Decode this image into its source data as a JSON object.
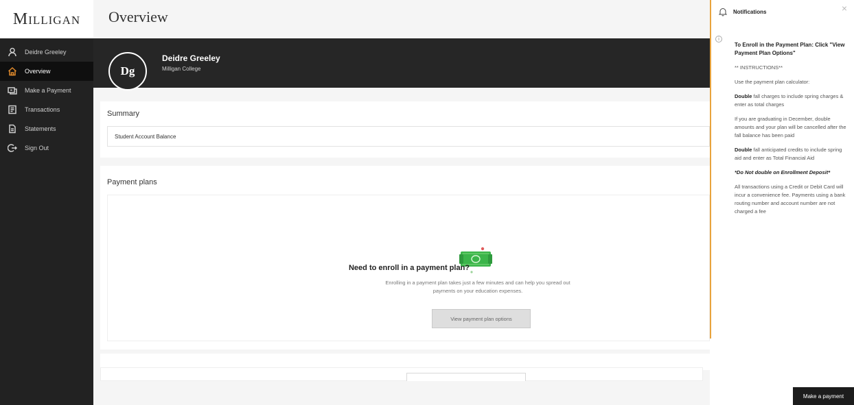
{
  "brand": {
    "logo_text": "Milligan"
  },
  "sidebar": {
    "items": [
      {
        "label": "Deidre Greeley",
        "icon": "user-icon"
      },
      {
        "label": "Overview",
        "icon": "home-icon",
        "active": true
      },
      {
        "label": "Make a Payment",
        "icon": "payment-icon"
      },
      {
        "label": "Transactions",
        "icon": "transactions-icon"
      },
      {
        "label": "Statements",
        "icon": "statements-icon"
      },
      {
        "label": "Sign Out",
        "icon": "sign-out-icon"
      }
    ]
  },
  "header": {
    "title": "Overview"
  },
  "profile": {
    "initials": "Dg",
    "name": "Deidre Greeley",
    "school": "Milligan College"
  },
  "summary": {
    "title": "Summary",
    "balance_label": "Student Account Balance"
  },
  "payment_plans": {
    "title": "Payment plans",
    "heading": "Need to enroll in a payment plan?",
    "description": "Enrolling in a payment plan takes just a few minutes and can help you spread out payments on your education expenses.",
    "button_label": "View payment plan options"
  },
  "notifications": {
    "title": "Notifications",
    "close_label": "×",
    "info_label": "i",
    "paragraphs": {
      "p1": "To Enroll in the Payment Plan: Click \"View Payment Plan Options\"",
      "p2": "** INSTRUCTIONS**",
      "p3": "Use the payment plan calculator:",
      "p4_bold": "Double",
      "p4_rest": " fall charges to include spring charges & enter as total charges",
      "p5": "If you are graduating in December, double amounts and your plan will be cancelled after the fall balance has been paid",
      "p6_bold": "Double",
      "p6_rest": " fall anticipated credits to include spring aid and enter as Total Financial Aid",
      "p7": "*Do Not double on Enrollment Deposit*",
      "p8": "All transactions using a Credit or Debit Card will incur a convenience fee. Payments using a bank routing number and account number are not charged a fee"
    }
  },
  "footer": {
    "make_payment_label": "Make a payment"
  },
  "colors": {
    "accent": "#e08a2c",
    "sidebar_bg": "#222222",
    "band_bg": "#262626",
    "money_green": "#3bb54a"
  }
}
